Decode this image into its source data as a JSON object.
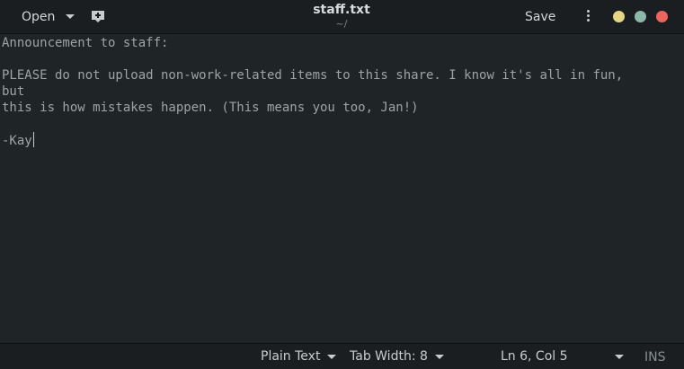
{
  "header": {
    "open_label": "Open",
    "title": "staff.txt",
    "subtitle": "~/",
    "save_label": "Save"
  },
  "editor": {
    "lines": [
      "Announcement to staff:",
      "",
      "PLEASE do not upload non-work-related items to this share. I know it's all in fun,",
      "but",
      "this is how mistakes happen. (This means you too, Jan!)",
      "",
      "-Kay"
    ]
  },
  "statusbar": {
    "language": "Plain Text",
    "tab_width": "Tab Width: 8",
    "position": "Ln 6, Col 5",
    "mode": "INS"
  },
  "colors": {
    "background": "#1f2527",
    "headerbar": "#1a1e20",
    "text": "#9ea3a5",
    "minimize": "#e6d583",
    "maximize": "#8dbaa8",
    "close": "#ee6560"
  },
  "icons": {
    "new_document": "new-document-icon",
    "menu": "vertical-dots-icon",
    "chevron": "chevron-down-icon"
  }
}
